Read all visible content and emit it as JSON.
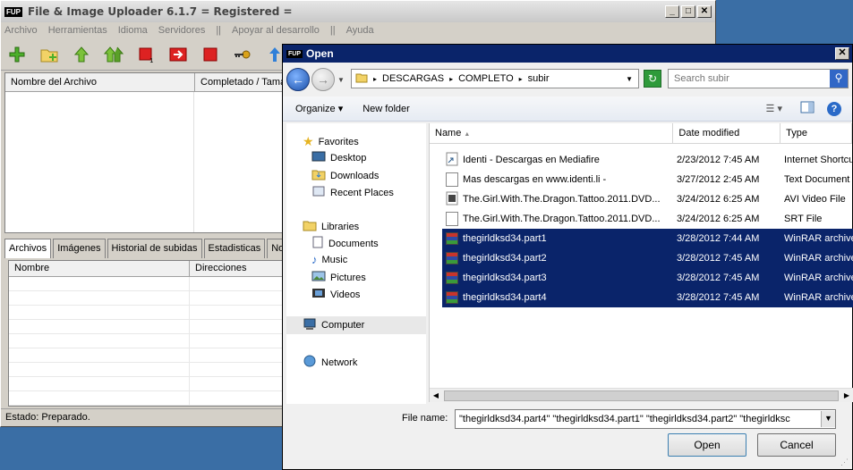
{
  "main": {
    "title": "File & Image Uploader 6.1.7   = Registered =",
    "logo": "FUP",
    "menu": [
      "Archivo",
      "Herramientas",
      "Idioma",
      "Servidores",
      "||",
      "Apoyar al desarrollo",
      "||",
      "Ayuda"
    ],
    "list_headers": [
      "Nombre del Archivo",
      "Completado / Tama"
    ],
    "tabs": [
      "Archivos",
      "Imágenes",
      "Historial de subidas",
      "Estadisticas",
      "Noti"
    ],
    "dir_headers": [
      "Nombre",
      "Direcciones"
    ],
    "status": "Estado: Preparado."
  },
  "dialog": {
    "title": "Open",
    "logo": "FUP",
    "path": [
      "DESCARGAS",
      "COMPLETO",
      "subir"
    ],
    "search_placeholder": "Search subir",
    "organize": "Organize",
    "new_folder": "New folder",
    "nav": {
      "favorites": "Favorites",
      "desktop": "Desktop",
      "downloads": "Downloads",
      "recent": "Recent Places",
      "libraries": "Libraries",
      "documents": "Documents",
      "music": "Music",
      "pictures": "Pictures",
      "videos": "Videos",
      "computer": "Computer",
      "network": "Network"
    },
    "columns": [
      "Name",
      "Date modified",
      "Type"
    ],
    "files": [
      {
        "name": "Identi - Descargas en Mediafire",
        "date": "2/23/2012 7:45 AM",
        "type": "Internet Shortcut",
        "icon": "shortcut-icon"
      },
      {
        "name": "Mas descargas en www.identi.li  -",
        "date": "3/27/2012 2:45 AM",
        "type": "Text Document",
        "icon": "text-file-icon"
      },
      {
        "name": "The.Girl.With.The.Dragon.Tattoo.2011.DVD...",
        "date": "3/24/2012 6:25 AM",
        "type": "AVI Video File",
        "icon": "video-file-icon"
      },
      {
        "name": "The.Girl.With.The.Dragon.Tattoo.2011.DVD...",
        "date": "3/24/2012 6:25 AM",
        "type": "SRT File",
        "icon": "generic-file-icon"
      },
      {
        "name": "thegirldksd34.part1",
        "date": "3/28/2012 7:44 AM",
        "type": "WinRAR archive",
        "icon": "winrar-icon"
      },
      {
        "name": "thegirldksd34.part2",
        "date": "3/28/2012 7:45 AM",
        "type": "WinRAR archive",
        "icon": "winrar-icon"
      },
      {
        "name": "thegirldksd34.part3",
        "date": "3/28/2012 7:45 AM",
        "type": "WinRAR archive",
        "icon": "winrar-icon"
      },
      {
        "name": "thegirldksd34.part4",
        "date": "3/28/2012 7:45 AM",
        "type": "WinRAR archive",
        "icon": "winrar-icon"
      }
    ],
    "filename_label": "File name:",
    "filename_value": "\"thegirldksd34.part4\" \"thegirldksd34.part1\" \"thegirldksd34.part2\" \"thegirldksc",
    "open": "Open",
    "cancel": "Cancel"
  }
}
